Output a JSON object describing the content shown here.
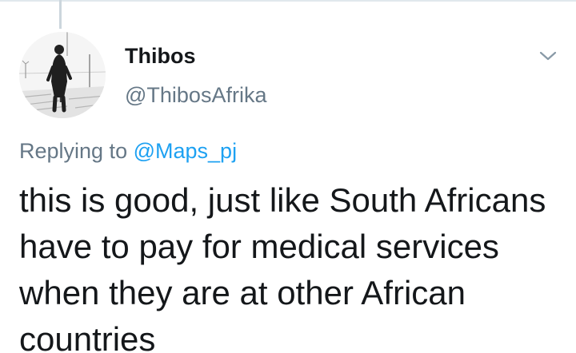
{
  "tweet": {
    "author": {
      "display_name": "Thibos",
      "handle": "@ThibosAfrika"
    },
    "reply": {
      "prefix": "Replying to",
      "mention": "@Maps_pj"
    },
    "text": "this is good, just like South Africans have to pay for medical services when they are at other African countries"
  },
  "icons": {
    "menu": "chevron-down-icon"
  },
  "colors": {
    "primary_text": "#14171a",
    "secondary_text": "#657786",
    "link": "#1da1f2",
    "divider": "#e1e8ed",
    "thread_line": "#ccd6dd"
  }
}
